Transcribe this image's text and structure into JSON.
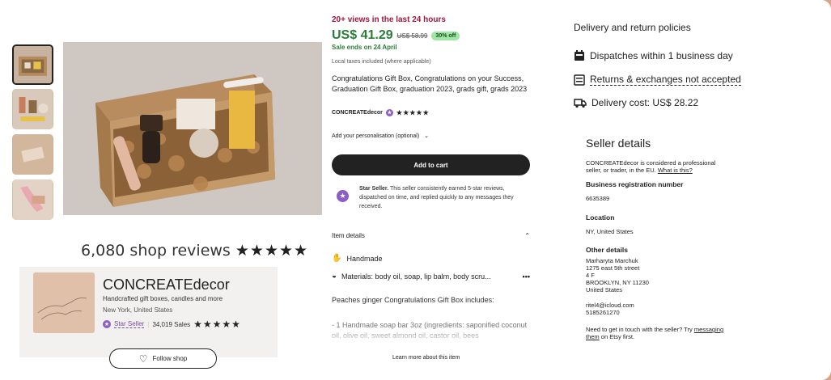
{
  "gallery": {
    "thumbnails": [
      "thumb-1",
      "thumb-2",
      "thumb-3",
      "thumb-4"
    ]
  },
  "reviews": {
    "count_text": "6,080 shop reviews",
    "stars": "★★★★★"
  },
  "shop": {
    "name": "CONCREATEdecor",
    "tagline": "Handcrafted gift boxes, candles and more",
    "location": "New York, United States",
    "star_seller": "Star Seller",
    "sales": "34,019 Sales",
    "stars": "★★★★★",
    "follow_label": "Follow shop"
  },
  "listing": {
    "views": "20+ views in the last 24 hours",
    "price": "US$ 41.29",
    "old_price": "US$ 58.99",
    "discount": "30% off",
    "sale_ends": "Sale ends on 24 April",
    "taxes": "Local taxes included (where applicable)",
    "title": "Congratulations Gift Box, Congratulations on your Success, Graduation Gift Box, graduation 2023, grads gift, grads 2023",
    "seller": "CONCREATEdecor",
    "seller_stars": "★★★★★",
    "personalisation": "Add your personalisation (optional)",
    "add_to_cart": "Add to cart",
    "star_seller_bold": "Star Seller.",
    "star_seller_text": " This seller consistently earned 5-star reviews, dispatched on time, and replied quickly to any messages they received.",
    "item_details": "Item details",
    "handmade": "Handmade",
    "materials": "Materials: body oil, soap, lip balm, body scru...",
    "description": "Peaches ginger Congratulations Gift Box includes:",
    "description_more": "- 1 Handmade soap bar 3oz (ingredients: saponified coconut oil, olive oil, sweet almond oil, castor oil, bees",
    "learn_more": "Learn more about this item"
  },
  "delivery": {
    "title": "Delivery and return policies",
    "dispatch": "Dispatches within 1 business day",
    "returns": "Returns & exchanges not accepted",
    "cost": "Delivery cost: US$ 28.22"
  },
  "seller_details": {
    "title": "Seller details",
    "intro": "CONCREATEdecor is considered a professional seller, or trader, in the EU.",
    "intro_link": "What is this?",
    "reg_label": "Business registration number",
    "reg_value": "6635389",
    "location_label": "Location",
    "location_value": "NY, United States",
    "other_label": "Other details",
    "other_lines": [
      "Marharyta Marchuk",
      "1275 east 5th street",
      "4 F",
      "BROOKLYN, NY 11230",
      "United States"
    ],
    "email": "ritel4@icloud.com",
    "phone": "5185261270",
    "contact_text": "Need to get in touch with the seller? Try",
    "contact_link": "messaging them",
    "contact_tail": " on Etsy first."
  },
  "colors": {
    "price_green": "#2a7d3a",
    "views_red": "#a1173f",
    "star_purple": "#8c5cc7",
    "background_frame": "#d4a58b"
  }
}
